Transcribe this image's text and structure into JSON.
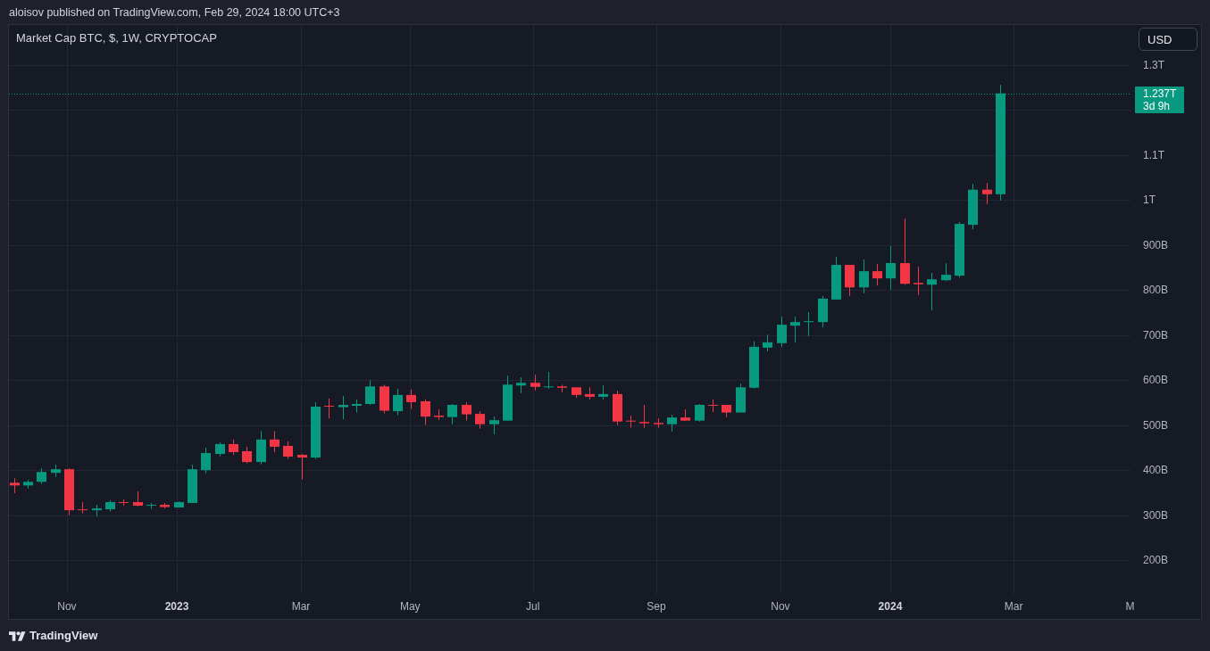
{
  "header": {
    "text": "aloisov published on TradingView.com, Feb 29, 2024 18:00 UTC+3"
  },
  "chart": {
    "price_axis": {
      "currency_button": "USD",
      "last_price": {
        "countdown": "3d 9h"
      }
    },
    "time_axis": {
      "ticks": [
        {
          "bold": false
        },
        {
          "bold": true
        },
        {
          "bold": false
        },
        {
          "bold": false
        },
        {
          "bold": false
        },
        {
          "bold": false
        },
        {
          "bold": false
        },
        {
          "bold": true
        },
        {
          "bold": false
        },
        {
          "bold": false
        }
      ]
    },
    "chart_data": {
      "type": "candlestick",
      "title": "Market Cap BTC, $, 1W, CRYPTOCAP",
      "grid": true,
      "xlim": [
        2022.7647,
        2024.3367
      ],
      "ylim": [
        125000000000.0,
        1389000000000.0
      ],
      "xticks": [
        {
          "value": 2022.846,
          "label": "Nov"
        },
        2023,
        {
          "value": 2023.174,
          "label": "Mar"
        },
        {
          "value": 2023.327,
          "label": "May"
        },
        {
          "value": 2023.499,
          "label": "Jul"
        },
        {
          "value": 2023.672,
          "label": "Sep"
        },
        {
          "value": 2023.846,
          "label": "Nov"
        },
        2024,
        {
          "value": 2024.173,
          "label": "Mar"
        },
        {
          "value": 2024.336,
          "label": "M"
        }
      ],
      "yticks": [
        {
          "value": 1300000000000.0,
          "label": "1.3T"
        },
        {
          "value": 1100000000000.0,
          "label": "1.1T"
        },
        {
          "value": 1000000000000.0,
          "label": "1T"
        },
        {
          "value": 900000000000.0,
          "label": "900B"
        },
        {
          "value": 800000000000.0,
          "label": "800B"
        },
        {
          "value": 700000000000.0,
          "label": "700B"
        },
        {
          "value": 600000000000.0,
          "label": "600B"
        },
        {
          "value": 500000000000.0,
          "label": "500B"
        },
        {
          "value": 400000000000.0,
          "label": "400B"
        },
        {
          "value": 300000000000.0,
          "label": "300B"
        },
        {
          "value": 200000000000.0,
          "label": "200B"
        }
      ],
      "ref_lines": [
        {
          "axis": "y",
          "value": 1237000000000.0,
          "label": "1.237T"
        }
      ],
      "x": [
        2022.7717,
        2022.7909,
        2022.8101,
        2022.8293,
        2022.8485,
        2022.8677,
        2022.8869,
        2022.9061,
        2022.9253,
        2022.9445,
        2022.9637,
        2022.9829,
        2023.0021,
        2023.0213,
        2023.0405,
        2023.0597,
        2023.0789,
        2023.0981,
        2023.1173,
        2023.1365,
        2023.1557,
        2023.1749,
        2023.1941,
        2023.2133,
        2023.2325,
        2023.2517,
        2023.2709,
        2023.2901,
        2023.3093,
        2023.3285,
        2023.3477,
        2023.3669,
        2023.3861,
        2023.4053,
        2023.4245,
        2023.4437,
        2023.4629,
        2023.4821,
        2023.5013,
        2023.5205,
        2023.5397,
        2023.5589,
        2023.5781,
        2023.5973,
        2023.6165,
        2023.6357,
        2023.6549,
        2023.6741,
        2023.6933,
        2023.7125,
        2023.7317,
        2023.7509,
        2023.7701,
        2023.7893,
        2023.8085,
        2023.8277,
        2023.8469,
        2023.8661,
        2023.8853,
        2023.9045,
        2023.9237,
        2023.9429,
        2023.9621,
        2023.9813,
        2024.0005,
        2024.0197,
        2024.0389,
        2024.0581,
        2024.0773,
        2024.0965,
        2024.1157,
        2024.1349,
        2024.1541
      ],
      "series": [
        {
          "ohlc": [
            [
              372000000000.0,
              382000000000.0,
              349000000000.0,
              366000000000.0
            ],
            [
              366000000000.0,
              378000000000.0,
              359000000000.0,
              374000000000.0
            ],
            [
              374000000000.0,
              404000000000.0,
              369000000000.0,
              396000000000.0
            ],
            [
              394000000000.0,
              412000000000.0,
              385000000000.0,
              402000000000.0
            ],
            [
              402000000000.0,
              404000000000.0,
              300000000000.0,
              311000000000.0
            ],
            [
              313000000000.0,
              329000000000.0,
              304000000000.0,
              311000000000.0
            ],
            [
              311000000000.0,
              323000000000.0,
              297000000000.0,
              315000000000.0
            ],
            [
              313000000000.0,
              333000000000.0,
              308000000000.0,
              329000000000.0
            ],
            [
              329000000000.0,
              335000000000.0,
              321000000000.0,
              327000000000.0
            ],
            [
              329000000000.0,
              353000000000.0,
              320000000000.0,
              321000000000.0
            ],
            [
              321000000000.0,
              327000000000.0,
              314000000000.0,
              323000000000.0
            ],
            [
              323000000000.0,
              327000000000.0,
              315000000000.0,
              318000000000.0
            ],
            [
              317000000000.0,
              331000000000.0,
              317000000000.0,
              329000000000.0
            ],
            [
              327000000000.0,
              412000000000.0,
              327000000000.0,
              402000000000.0
            ],
            [
              400000000000.0,
              450000000000.0,
              393000000000.0,
              438000000000.0
            ],
            [
              436000000000.0,
              462000000000.0,
              431000000000.0,
              458000000000.0
            ],
            [
              458000000000.0,
              468000000000.0,
              434000000000.0,
              440000000000.0
            ],
            [
              442000000000.0,
              452000000000.0,
              415000000000.0,
              418000000000.0
            ],
            [
              418000000000.0,
              487000000000.0,
              413000000000.0,
              468000000000.0
            ],
            [
              468000000000.0,
              487000000000.0,
              440000000000.0,
              452000000000.0
            ],
            [
              454000000000.0,
              464000000000.0,
              425000000000.0,
              430000000000.0
            ],
            [
              434000000000.0,
              436000000000.0,
              379000000000.0,
              428000000000.0
            ],
            [
              428000000000.0,
              551000000000.0,
              425000000000.0,
              541000000000.0
            ],
            [
              543000000000.0,
              559000000000.0,
              515000000000.0,
              541000000000.0
            ],
            [
              540000000000.0,
              565000000000.0,
              513000000000.0,
              545000000000.0
            ],
            [
              543000000000.0,
              557000000000.0,
              528000000000.0,
              547000000000.0
            ],
            [
              547000000000.0,
              600000000000.0,
              545000000000.0,
              586000000000.0
            ],
            [
              586000000000.0,
              590000000000.0,
              526000000000.0,
              532000000000.0
            ],
            [
              531000000000.0,
              581000000000.0,
              522000000000.0,
              567000000000.0
            ],
            [
              567000000000.0,
              579000000000.0,
              536000000000.0,
              551000000000.0
            ],
            [
              553000000000.0,
              557000000000.0,
              500000000000.0,
              519000000000.0
            ],
            [
              521000000000.0,
              535000000000.0,
              512000000000.0,
              518000000000.0
            ],
            [
              518000000000.0,
              547000000000.0,
              502000000000.0,
              545000000000.0
            ],
            [
              545000000000.0,
              551000000000.0,
              510000000000.0,
              524000000000.0
            ],
            [
              525000000000.0,
              531000000000.0,
              492000000000.0,
              502000000000.0
            ],
            [
              502000000000.0,
              519000000000.0,
              480000000000.0,
              511000000000.0
            ],
            [
              510000000000.0,
              610000000000.0,
              510000000000.0,
              590000000000.0
            ],
            [
              588000000000.0,
              606000000000.0,
              571000000000.0,
              594000000000.0
            ],
            [
              594000000000.0,
              612000000000.0,
              577000000000.0,
              585000000000.0
            ],
            [
              585000000000.0,
              618000000000.0,
              581000000000.0,
              586000000000.0
            ],
            [
              586000000000.0,
              590000000000.0,
              573000000000.0,
              583000000000.0
            ],
            [
              584000000000.0,
              584000000000.0,
              561000000000.0,
              567000000000.0
            ],
            [
              569000000000.0,
              584000000000.0,
              557000000000.0,
              563000000000.0
            ],
            [
              563000000000.0,
              588000000000.0,
              557000000000.0,
              569000000000.0
            ],
            [
              569000000000.0,
              577000000000.0,
              500000000000.0,
              508000000000.0
            ],
            [
              510000000000.0,
              521000000000.0,
              494000000000.0,
              508000000000.0
            ],
            [
              507000000000.0,
              545000000000.0,
              494000000000.0,
              504000000000.0
            ],
            [
              505000000000.0,
              515000000000.0,
              494000000000.0,
              502000000000.0
            ],
            [
              502000000000.0,
              523000000000.0,
              486000000000.0,
              517000000000.0
            ],
            [
              517000000000.0,
              535000000000.0,
              510000000000.0,
              510000000000.0
            ],
            [
              510000000000.0,
              547000000000.0,
              508000000000.0,
              545000000000.0
            ],
            [
              545000000000.0,
              557000000000.0,
              529000000000.0,
              543000000000.0
            ],
            [
              545000000000.0,
              545000000000.0,
              518000000000.0,
              528000000000.0
            ],
            [
              528000000000.0,
              592000000000.0,
              528000000000.0,
              584000000000.0
            ],
            [
              583000000000.0,
              686000000000.0,
              581000000000.0,
              674000000000.0
            ],
            [
              672000000000.0,
              701000000000.0,
              664000000000.0,
              684000000000.0
            ],
            [
              682000000000.0,
              741000000000.0,
              674000000000.0,
              723000000000.0
            ],
            [
              721000000000.0,
              741000000000.0,
              684000000000.0,
              729000000000.0
            ],
            [
              730000000000.0,
              751000000000.0,
              697000000000.0,
              731000000000.0
            ],
            [
              729000000000.0,
              787000000000.0,
              717000000000.0,
              781000000000.0
            ],
            [
              779000000000.0,
              874000000000.0,
              779000000000.0,
              856000000000.0
            ],
            [
              856000000000.0,
              856000000000.0,
              787000000000.0,
              806000000000.0
            ],
            [
              806000000000.0,
              868000000000.0,
              793000000000.0,
              842000000000.0
            ],
            [
              842000000000.0,
              858000000000.0,
              810000000000.0,
              826000000000.0
            ],
            [
              826000000000.0,
              898000000000.0,
              801000000000.0,
              860000000000.0
            ],
            [
              860000000000.0,
              959000000000.0,
              812000000000.0,
              814000000000.0
            ],
            [
              816000000000.0,
              852000000000.0,
              789000000000.0,
              813000000000.0
            ],
            [
              812000000000.0,
              838000000000.0,
              755000000000.0,
              824000000000.0
            ],
            [
              822000000000.0,
              860000000000.0,
              820000000000.0,
              834000000000.0
            ],
            [
              832000000000.0,
              951000000000.0,
              828000000000.0,
              947000000000.0
            ],
            [
              945000000000.0,
              1036000000000.0,
              935000000000.0,
              1023000000000.0
            ],
            [
              1023000000000.0,
              1038000000000.0,
              991000000000.0,
              1013000000000.0
            ],
            [
              1013000000000.0,
              1256000000000.0,
              999000000000.0,
              1237000000000.0
            ]
          ]
        }
      ]
    }
  },
  "footer": {
    "logo_text": "TradingView"
  }
}
